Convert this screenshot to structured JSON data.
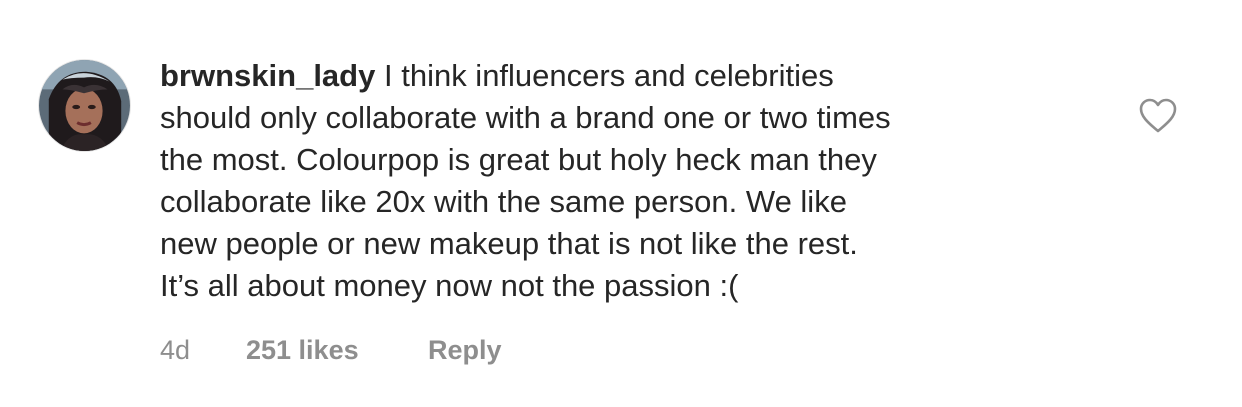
{
  "comment": {
    "username": "brwnskin_lady",
    "lines": [
      "I think influencers and celebrities",
      "should only collaborate with a brand one or two times",
      "the most. Colourpop is great but holy heck man they",
      "collaborate like 20x with the same person. We like",
      "new people or new makeup that is not like the rest.",
      "It’s all about money now not the passion :("
    ],
    "time": "4d",
    "likes": "251 likes",
    "reply_label": "Reply",
    "like_icon": "heart-outline-icon"
  },
  "colors": {
    "text": "#262626",
    "secondary": "#8e8e8e",
    "icon": "#8e8e8e"
  }
}
